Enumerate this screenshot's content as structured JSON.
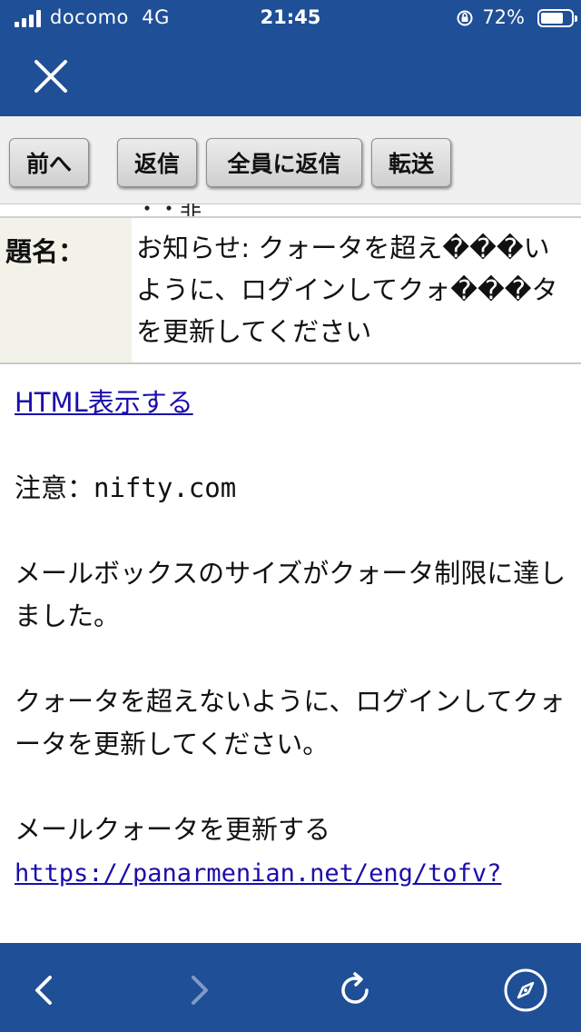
{
  "status_bar": {
    "carrier": "docomo",
    "network": "4G",
    "time": "21:45",
    "battery_percent": "72%",
    "battery_level": 0.72
  },
  "nav": {
    "close_icon": "close-icon"
  },
  "toolbar": {
    "prev_label": "前へ",
    "reply_label": "返信",
    "reply_all_label": "全員に返信",
    "forward_label": "転送"
  },
  "header": {
    "clipped_row_text": "・・非",
    "subject_label": "題名：",
    "subject_value": "お知らせ: クォータを超え���いように、ログインしてクォ���タを更新してください"
  },
  "body": {
    "html_link": "HTML表示する",
    "notice_prefix": "注意：",
    "notice_domain": "nifty.com",
    "paragraph1": "メールボックスのサイズがクォータ制限に達しました。",
    "paragraph2": "クォータを超えないように、ログインしてクォータを更新してください。",
    "paragraph3": "メールクォータを更新する",
    "url": "https://panarmenian.net/eng/tofv?"
  },
  "bottom_bar": {
    "icons": [
      "back-icon",
      "forward-icon",
      "reload-icon",
      "safari-compass-icon"
    ]
  },
  "colors": {
    "bar_blue": "#1f4f96",
    "link_blue": "#1a0dab",
    "label_bg": "#f2f2e8"
  }
}
